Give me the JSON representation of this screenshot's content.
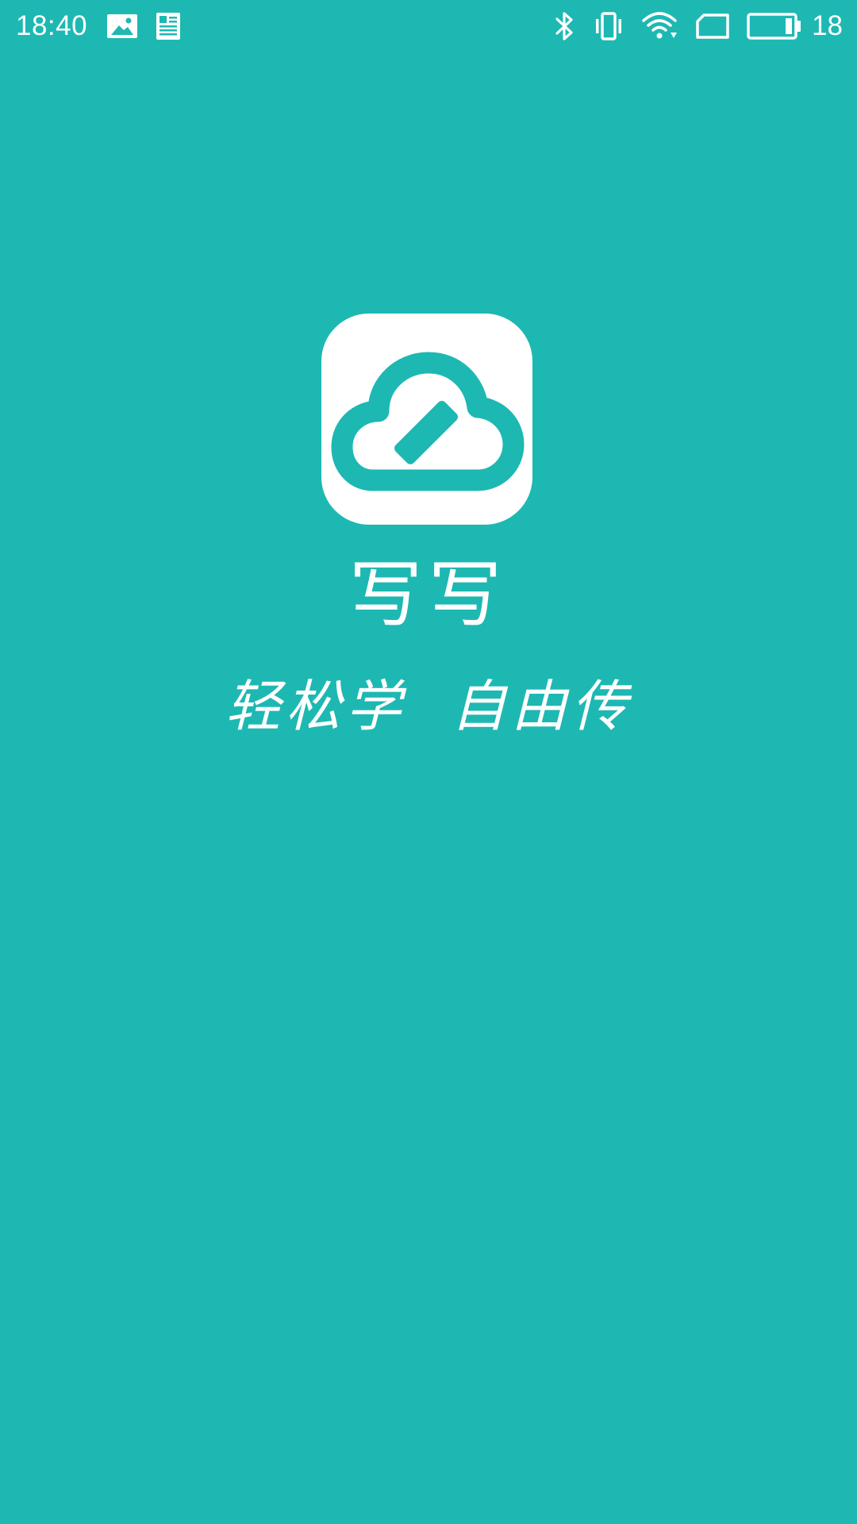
{
  "status_bar": {
    "time": "18:40",
    "battery_level": "18",
    "left_icons": [
      "image-notification-icon",
      "news-notification-icon"
    ],
    "right_icons": [
      "bluetooth-icon",
      "vibrate-icon",
      "wifi-icon",
      "sim-icon",
      "battery-icon"
    ]
  },
  "splash": {
    "app_name": "写写",
    "slogan": "轻松学  自由传",
    "logo_icon": "cloud-pencil-icon"
  },
  "colors": {
    "background": "#1EB8B3",
    "foreground": "#FFFFFF"
  }
}
